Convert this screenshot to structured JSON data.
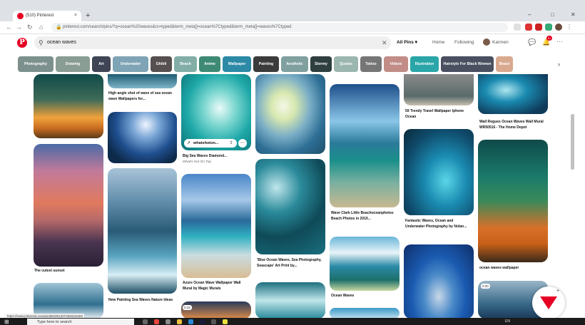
{
  "browser": {
    "tab_title": "(510) Pinterest",
    "tab_close": "×",
    "new_tab": "+",
    "win_min": "–",
    "win_max": "□",
    "win_close": "✕",
    "back": "←",
    "forward": "→",
    "reload": "↻",
    "home": "⌂",
    "url": "pinterest.com/search/pins/?q=ocean%20waves&rs=typed&term_meta[]=ocean%7Ctyped&term_meta[]=waves%7Ctyped"
  },
  "header": {
    "logo": "P",
    "search_value": "ocean waves",
    "search_clear": "✕",
    "all_pins": "All Pins ▾",
    "nav_home": "Home",
    "nav_following": "Following",
    "user_name": "Karmen",
    "notif_count": "9+",
    "more": "⋯"
  },
  "chips": [
    "Photography",
    "Drawing",
    "Art",
    "Underwater",
    "Ghibli",
    "Beach",
    "Anime",
    "Wallpaper",
    "Painting",
    "Aesthetic",
    "Stormy",
    "Quotes",
    "Tattoo",
    "Videos",
    "Illustration",
    "Hairstyle For Black Women",
    "Beaut"
  ],
  "chip_colors": [
    "#7c918d",
    "#8a9d94",
    "#3f4554",
    "#7fa4b5",
    "#575050",
    "#82aea7",
    "#3e8a74",
    "#2c8aa6",
    "#3b3b3b",
    "#7fa09f",
    "#2f3f3f",
    "#9bb6ae",
    "#767676",
    "#c28d87",
    "#2aa6a8",
    "#4a5060",
    "#d9a98f"
  ],
  "pins": {
    "c1p1_caption": "The cutest sunset",
    "c2p1_caption": "High angle shot of wave of sea ocean wave Wallpapers for...",
    "c2p3_caption": "New Painting Sea Waves Nature Ideas",
    "c3p1_source": "whatshoton...",
    "c3p1_caption": "Big Sea Waves Diamond...",
    "c3p1_sub": "What's Hot On Top",
    "c3p2_caption": "Azure Ocean Wave Wallpaper Wall Mural by Magic Murals",
    "c3p3_badge": "0:15",
    "c4p2_caption": "'Blue Ocean Waves, Sea Photography, Seascape' Art Print by...",
    "c5p1_caption": "Wave Clark Little Beachoceanphotos Beach Photos in 2019...",
    "c5p2_caption": "Ocean Waves",
    "c6p1_caption": "59 Trendy Travel Wallpaper Iphone Ocean",
    "c6p2_caption": "Fantastic Waves, Ocean and Underwater Photography by Nolan...",
    "c7p1_caption": "Wall Rogues Ocean Waves Wall Mural WR50516 - The Home Depot",
    "c7p2_caption": "ocean waves wallpaper",
    "c7p3_badge": "0:30"
  },
  "status_url": "https://www.pinterest.com/pin/581801207265031630/",
  "taskbar": {
    "start": "⊞",
    "search_placeholder": "Type here to search",
    "lang": "EN"
  }
}
